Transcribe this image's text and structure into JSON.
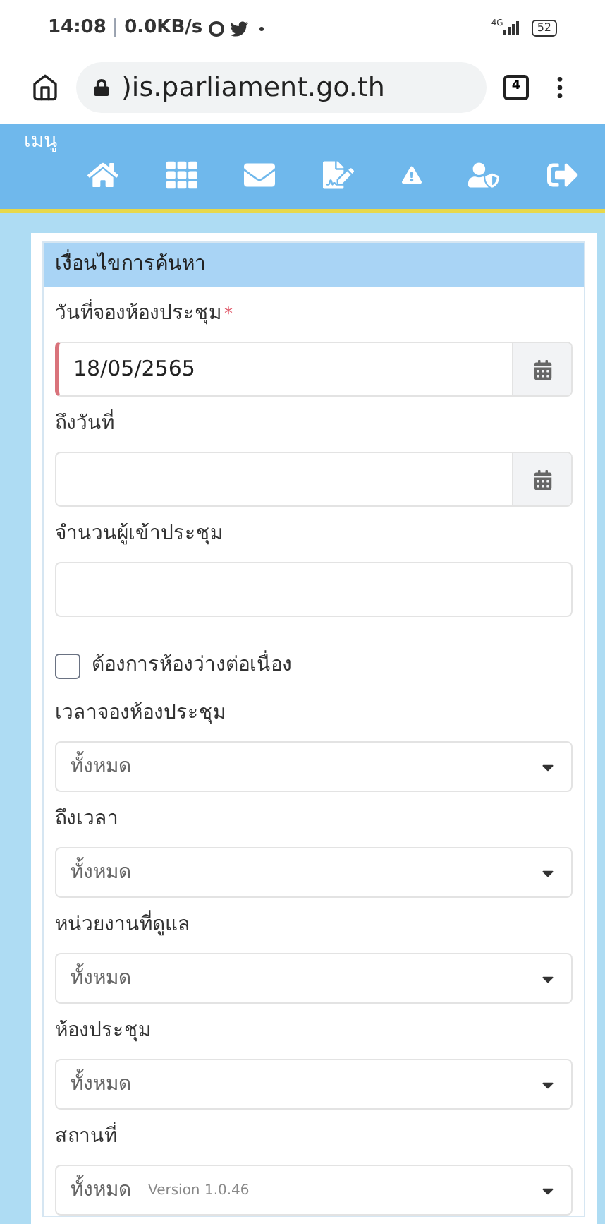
{
  "status_bar": {
    "time": "14:08",
    "separator": "|",
    "speed": "0.0KB/s",
    "network": "4G",
    "battery": "52"
  },
  "browser": {
    "url": ")is.parliament.go.th",
    "tab_count": "4"
  },
  "menu": {
    "title": "เมนู",
    "items": [
      {
        "kind": "home"
      },
      {
        "kind": "grid"
      },
      {
        "kind": "mail"
      },
      {
        "kind": "sign"
      },
      {
        "kind": "warning"
      },
      {
        "kind": "user"
      },
      {
        "kind": "logout"
      }
    ]
  },
  "panel": {
    "title": "เงื่อนไขการค้นหา",
    "fields": [
      {
        "kind": "date",
        "label": "วันที่จองห้องประชุม",
        "required_mark": "*",
        "value": "18/05/2565",
        "error": true
      },
      {
        "kind": "date",
        "label": "ถึงวันที่",
        "error": false
      },
      {
        "kind": "text",
        "label": "จำนวนผู้เข้าประชุม"
      },
      {
        "kind": "checkbox",
        "label": "ต้องการห้องว่างต่อเนื่อง",
        "checked": false
      },
      {
        "kind": "select",
        "label": "เวลาจองห้องประชุม",
        "value": "ทั้งหมด"
      },
      {
        "kind": "select",
        "label": "ถึงเวลา",
        "value": "ทั้งหมด"
      },
      {
        "kind": "select",
        "label": "หน่วยงานที่ดูแล",
        "value": "ทั้งหมด"
      },
      {
        "kind": "select",
        "label": "ห้องประชุม",
        "value": "ทั้งหมด"
      },
      {
        "kind": "select",
        "label": "สถานที่",
        "value": "ทั้งหมด",
        "note": "Version 1.0.46"
      }
    ]
  }
}
